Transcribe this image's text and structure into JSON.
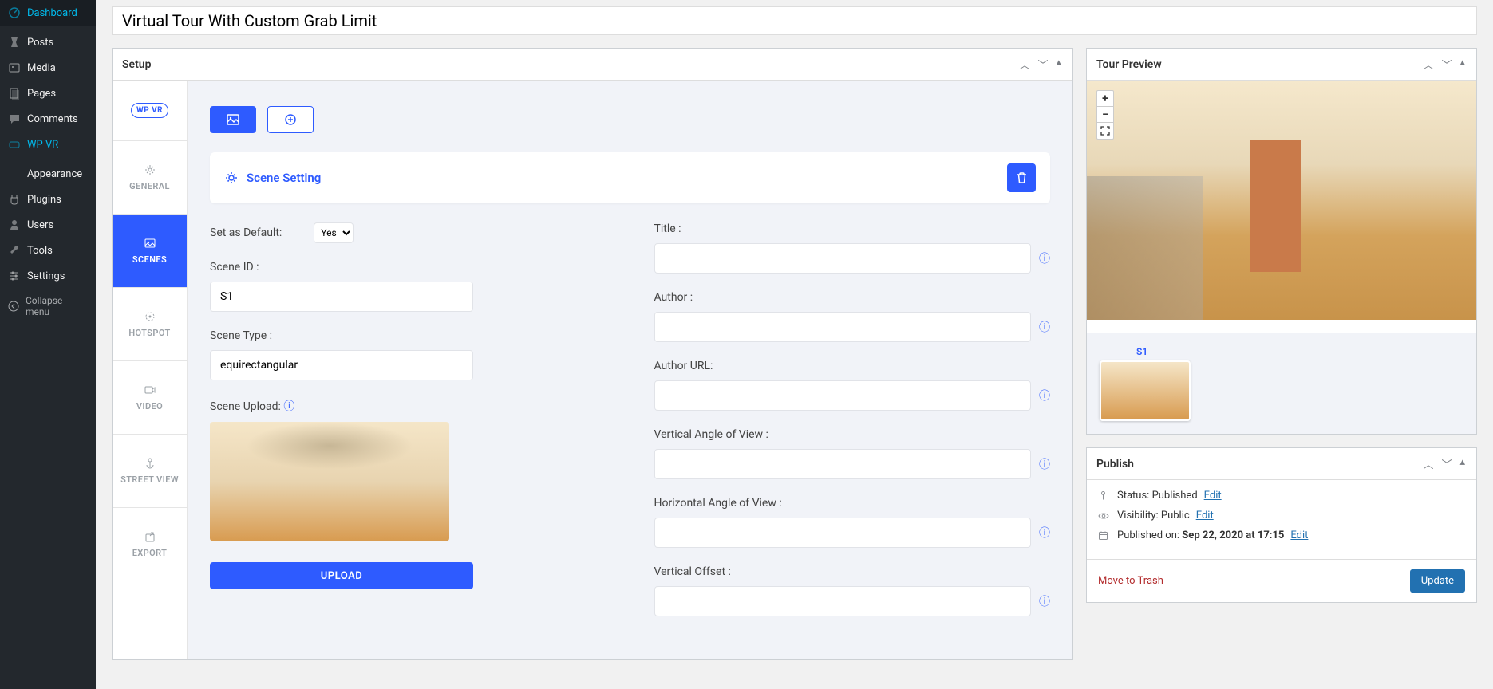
{
  "wp_menu": {
    "dashboard": "Dashboard",
    "posts": "Posts",
    "media": "Media",
    "pages": "Pages",
    "comments": "Comments",
    "wpvr": "WP VR",
    "appearance": "Appearance",
    "plugins": "Plugins",
    "users": "Users",
    "tools": "Tools",
    "settings": "Settings",
    "collapse": "Collapse menu"
  },
  "title": "Virtual Tour With Custom Grab Limit",
  "setup": {
    "heading": "Setup",
    "logo_text": "WP VR",
    "tabs": {
      "general": "GENERAL",
      "scenes": "SCENES",
      "hotspot": "HOTSPOT",
      "video": "VIDEO",
      "street": "STREET VIEW",
      "export": "EXPORT"
    },
    "scene_setting": "Scene Setting",
    "fields": {
      "set_default": "Set as Default:",
      "default_value": "Yes",
      "scene_id": "Scene ID :",
      "scene_id_value": "S1",
      "scene_type": "Scene Type :",
      "scene_type_value": "equirectangular",
      "scene_upload": "Scene Upload:",
      "upload_btn": "UPLOAD",
      "title": "Title :",
      "author": "Author :",
      "author_url": "Author URL:",
      "v_angle": "Vertical Angle of View :",
      "h_angle": "Horizontal Angle of View :",
      "v_offset": "Vertical Offset :"
    }
  },
  "preview": {
    "heading": "Tour Preview",
    "gallery_label": "S1"
  },
  "publish": {
    "heading": "Publish",
    "status_label": "Status:",
    "status_value": "Published",
    "visibility_label": "Visibility:",
    "visibility_value": "Public",
    "published_label": "Published on:",
    "published_value": "Sep 22, 2020 at 17:15",
    "edit": "Edit",
    "trash": "Move to Trash",
    "update": "Update"
  }
}
